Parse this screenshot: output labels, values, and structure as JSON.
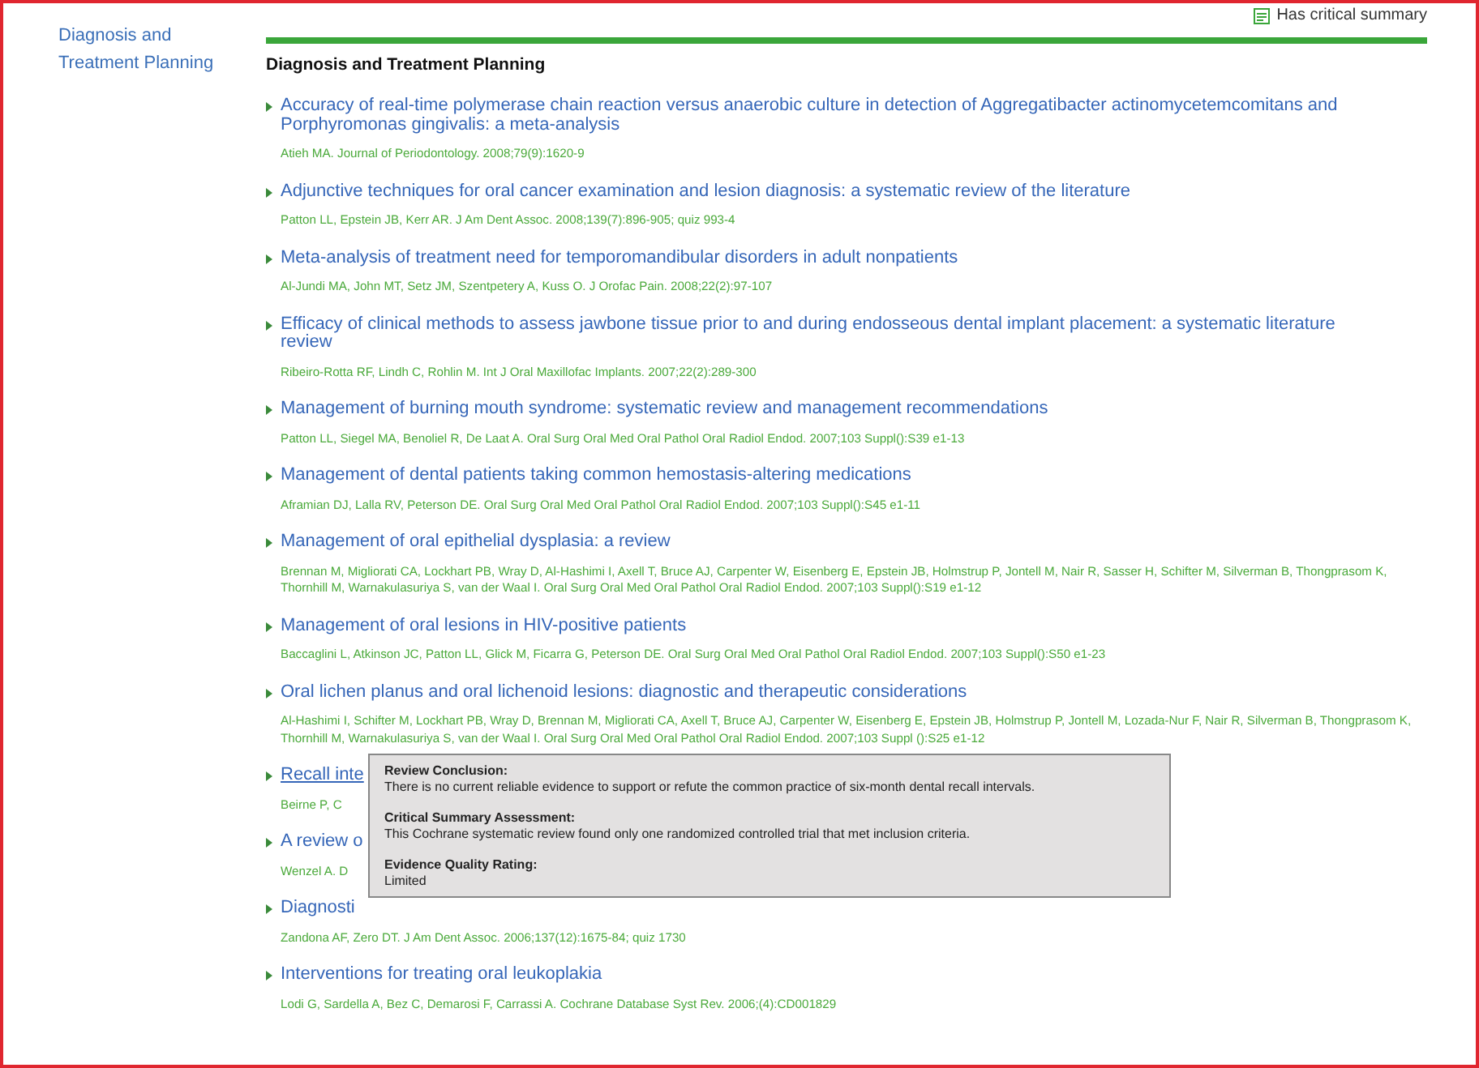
{
  "header": {
    "legend": "Has critical summary"
  },
  "sidebar": {
    "items": [
      {
        "label": "Diagnosis and Treatment Planning",
        "selected": true
      }
    ]
  },
  "section": {
    "title": "Diagnosis and Treatment Planning"
  },
  "articles": [
    {
      "title": "Accuracy of real-time polymerase chain reaction versus anaerobic culture in detection of Aggregatibacter actinomycetemcomitans and Porphyromonas gingivalis: a meta-analysis",
      "citation": "Atieh MA. Journal of Periodontology. 2008;79(9):1620-9",
      "hovered": false
    },
    {
      "title": "Adjunctive techniques for oral cancer examination and lesion diagnosis: a systematic review of the literature",
      "citation": "Patton LL, Epstein JB, Kerr AR. J Am Dent Assoc. 2008;139(7):896-905; quiz 993-4",
      "hovered": false
    },
    {
      "title": "Meta-analysis of treatment need for temporomandibular disorders in adult nonpatients",
      "citation": "Al-Jundi MA, John MT, Setz JM, Szentpetery A, Kuss O. J Orofac Pain. 2008;22(2):97-107",
      "hovered": false
    },
    {
      "title": "Efficacy of clinical methods to assess jawbone tissue prior to and during endosseous dental implant placement: a systematic literature review",
      "citation": "Ribeiro-Rotta RF, Lindh C, Rohlin M. Int J Oral Maxillofac Implants. 2007;22(2):289-300",
      "hovered": false
    },
    {
      "title": "Management of burning mouth syndrome: systematic review and management recommendations",
      "citation": "Patton LL, Siegel MA, Benoliel R, De Laat A. Oral Surg Oral Med Oral Pathol Oral Radiol Endod. 2007;103 Suppl():S39 e1-13",
      "hovered": false
    },
    {
      "title": "Management of dental patients taking common hemostasis-altering medications",
      "citation": "Aframian DJ, Lalla RV, Peterson DE. Oral Surg Oral Med Oral Pathol Oral Radiol Endod. 2007;103 Suppl():S45 e1-11",
      "hovered": false
    },
    {
      "title": "Management of oral epithelial dysplasia: a review",
      "citation": "Brennan M, Migliorati CA, Lockhart PB, Wray D, Al-Hashimi I, Axell T, Bruce AJ, Carpenter W, Eisenberg E, Epstein JB, Holmstrup P, Jontell M, Nair R, Sasser H, Schifter M, Silverman B, Thongprasom K, Thornhill M, Warnakulasuriya S, van der Waal I. Oral Surg Oral Med Oral Pathol Oral Radiol Endod. 2007;103 Suppl():S19 e1-12",
      "hovered": false
    },
    {
      "title": "Management of oral lesions in HIV-positive patients",
      "citation": "Baccaglini L, Atkinson JC, Patton LL, Glick M, Ficarra G, Peterson DE. Oral Surg Oral Med Oral Pathol Oral Radiol Endod. 2007;103 Suppl():S50 e1-23",
      "hovered": false
    },
    {
      "title": "Oral lichen planus and oral lichenoid lesions: diagnostic and therapeutic considerations",
      "citation": "Al-Hashimi I, Schifter M, Lockhart PB, Wray D, Brennan M, Migliorati CA, Axell T, Bruce AJ, Carpenter W, Eisenberg E, Epstein JB, Holmstrup P, Jontell M, Lozada-Nur F, Nair R, Silverman B, Thongprasom K, Thornhill M, Warnakulasuriya S, van der Waal I. Oral Surg Oral Med Oral Pathol Oral Radiol Endod. 2007;103 Suppl ():S25 e1-12",
      "hovered": false
    },
    {
      "title": "Recall inte",
      "citation": "Beirne P, C",
      "hovered": true
    },
    {
      "title": "A review o",
      "citation": "Wenzel A. D",
      "hovered": false
    },
    {
      "title": "Diagnosti",
      "citation": "Zandona AF, Zero DT. J Am Dent Assoc. 2006;137(12):1675-84; quiz 1730",
      "hovered": false
    },
    {
      "title": "Interventions for treating oral leukoplakia",
      "citation": "Lodi G, Sardella A, Bez C, Demarosi F, Carrassi A. Cochrane Database Syst Rev. 2006;(4):CD001829",
      "hovered": false
    }
  ],
  "tooltip": {
    "sections": [
      {
        "heading": "Review Conclusion:",
        "text": "There is no current reliable evidence to support or refute the common practice of six-month dental recall intervals."
      },
      {
        "heading": "Critical Summary Assessment:",
        "text": "This Cochrane systematic review found only one randomized controlled trial that met inclusion criteria."
      },
      {
        "heading": "Evidence Quality Rating:",
        "text": "Limited"
      }
    ]
  }
}
